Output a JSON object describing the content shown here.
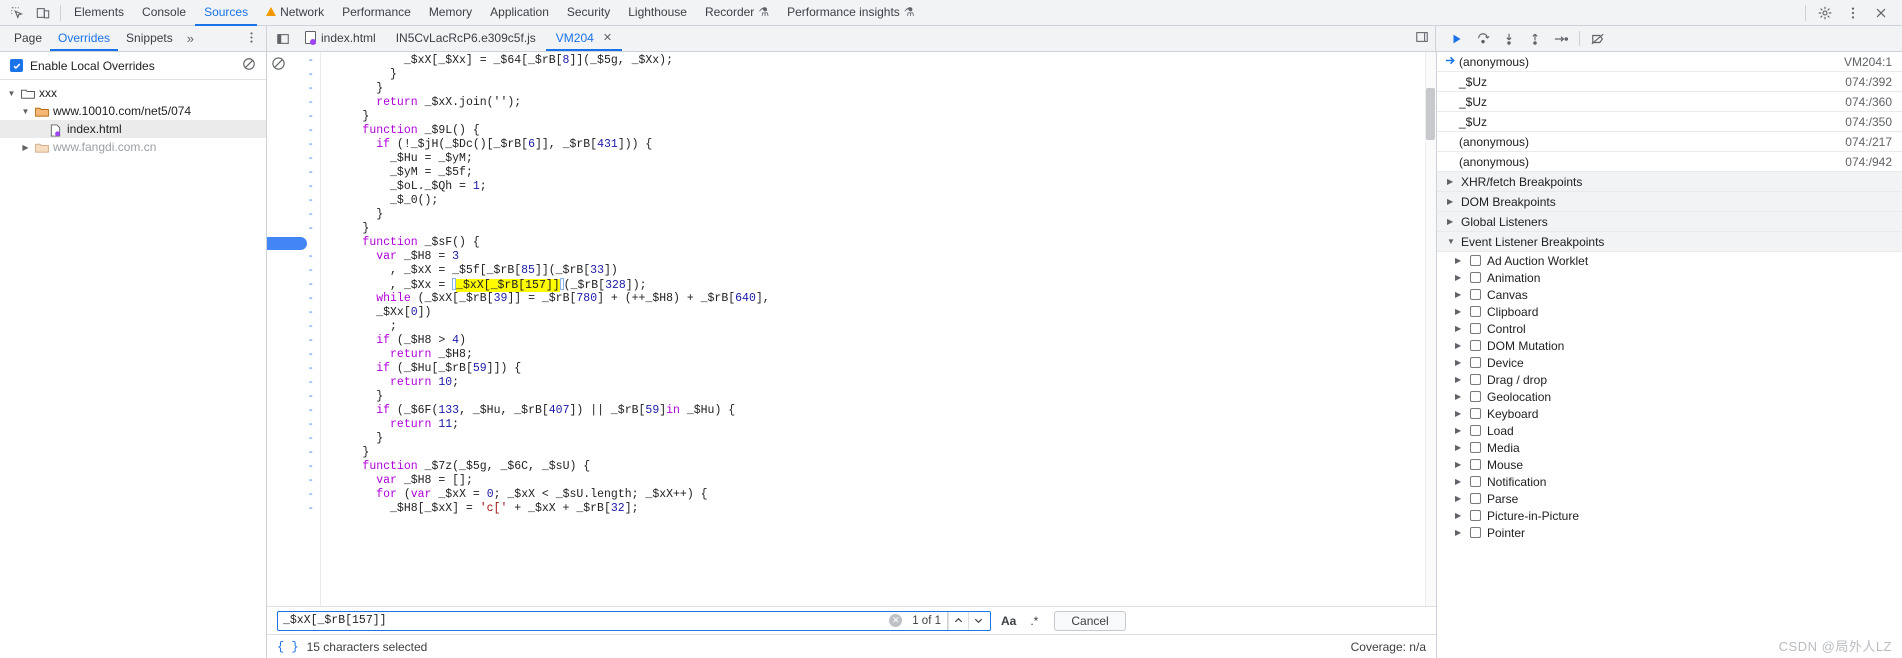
{
  "topbar": {
    "inspect_icon": "inspect-element-icon",
    "device_icon": "device-toolbar-icon",
    "tabs": [
      {
        "label": "Elements",
        "active": false,
        "warn": false,
        "flask": false
      },
      {
        "label": "Console",
        "active": false,
        "warn": false,
        "flask": false
      },
      {
        "label": "Sources",
        "active": true,
        "warn": false,
        "flask": false
      },
      {
        "label": "Network",
        "active": false,
        "warn": true,
        "flask": false
      },
      {
        "label": "Performance",
        "active": false,
        "warn": false,
        "flask": false
      },
      {
        "label": "Memory",
        "active": false,
        "warn": false,
        "flask": false
      },
      {
        "label": "Application",
        "active": false,
        "warn": false,
        "flask": false
      },
      {
        "label": "Security",
        "active": false,
        "warn": false,
        "flask": false
      },
      {
        "label": "Lighthouse",
        "active": false,
        "warn": false,
        "flask": false
      },
      {
        "label": "Recorder",
        "active": false,
        "warn": false,
        "flask": true
      },
      {
        "label": "Performance insights",
        "active": false,
        "warn": false,
        "flask": true
      }
    ],
    "settings_icon": "gear-icon",
    "more_icon": "more-vertical-icon",
    "close_icon": "close-icon"
  },
  "navigator": {
    "tabs": [
      {
        "label": "Page",
        "active": false
      },
      {
        "label": "Overrides",
        "active": true
      },
      {
        "label": "Snippets",
        "active": false
      }
    ],
    "more_label": "»",
    "kebab": "more-options-icon",
    "overrides_checkbox_label": "Enable Local Overrides",
    "overrides_checked": true,
    "clear_icon": "clear-overrides-icon",
    "tree": [
      {
        "label": "xxx",
        "depth": 0,
        "expanded": true,
        "type": "folder-plain",
        "selected": false,
        "muted": false
      },
      {
        "label": "www.10010.com/net5/074",
        "depth": 1,
        "expanded": true,
        "type": "folder-override",
        "selected": false,
        "muted": false
      },
      {
        "label": "index.html",
        "depth": 2,
        "expanded": null,
        "type": "file",
        "selected": true,
        "muted": false
      },
      {
        "label": "www.fangdi.com.cn",
        "depth": 1,
        "expanded": false,
        "type": "folder-override",
        "selected": false,
        "muted": true
      }
    ]
  },
  "editor": {
    "panel_toggle_icon": "show-navigator-icon",
    "tabs": [
      {
        "label": "index.html",
        "active": false,
        "icon": "html-file-override-icon",
        "closable": false
      },
      {
        "label": "IN5CvLacRcP6.e309c5f.js",
        "active": false,
        "icon": null,
        "closable": false
      },
      {
        "label": "VM204",
        "active": true,
        "icon": null,
        "closable": true
      }
    ],
    "tab_overflow_icon": "more-tabs-icon",
    "breakpoint_line_index": 13,
    "line_marker": "-",
    "lines": [
      [
        {
          "t": "            _$xX[_$Xx] = _$64[_$rB[",
          "c": ""
        },
        {
          "t": "8",
          "c": "n"
        },
        {
          "t": "]](_$5g, _$Xx);",
          "c": ""
        }
      ],
      [
        {
          "t": "          }",
          "c": ""
        }
      ],
      [
        {
          "t": "        }",
          "c": ""
        }
      ],
      [
        {
          "t": "        ",
          "c": ""
        },
        {
          "t": "return",
          "c": "k"
        },
        {
          "t": " _$xX.join('');",
          "c": ""
        }
      ],
      [
        {
          "t": "      }",
          "c": ""
        }
      ],
      [
        {
          "t": "      ",
          "c": ""
        },
        {
          "t": "function",
          "c": "k"
        },
        {
          "t": " _$9L() {",
          "c": ""
        }
      ],
      [
        {
          "t": "        ",
          "c": ""
        },
        {
          "t": "if",
          "c": "k"
        },
        {
          "t": " (!_$jH(_$Dc()[_$rB[",
          "c": ""
        },
        {
          "t": "6",
          "c": "n"
        },
        {
          "t": "]], _$rB[",
          "c": ""
        },
        {
          "t": "431",
          "c": "n"
        },
        {
          "t": "])) {",
          "c": ""
        }
      ],
      [
        {
          "t": "          _$Hu = _$yM;",
          "c": ""
        }
      ],
      [
        {
          "t": "          _$yM = _$5f;",
          "c": ""
        }
      ],
      [
        {
          "t": "          _$oL._$Qh = ",
          "c": ""
        },
        {
          "t": "1",
          "c": "n"
        },
        {
          "t": ";",
          "c": ""
        }
      ],
      [
        {
          "t": "          _$_0();",
          "c": ""
        }
      ],
      [
        {
          "t": "        }",
          "c": ""
        }
      ],
      [
        {
          "t": "      }",
          "c": ""
        }
      ],
      [
        {
          "t": "      ",
          "c": ""
        },
        {
          "t": "function",
          "c": "k"
        },
        {
          "t": " _$sF() {",
          "c": ""
        }
      ],
      [
        {
          "t": "        ",
          "c": ""
        },
        {
          "t": "var",
          "c": "k"
        },
        {
          "t": " _$H8 = ",
          "c": ""
        },
        {
          "t": "3",
          "c": "n"
        }
      ],
      [
        {
          "t": "          , _$xX = _$5f[_$rB[",
          "c": ""
        },
        {
          "t": "85",
          "c": "n"
        },
        {
          "t": "]](_$rB[",
          "c": ""
        },
        {
          "t": "33",
          "c": "n"
        },
        {
          "t": "])",
          "c": ""
        }
      ],
      [
        {
          "t": "          , _$Xx = ",
          "c": ""
        },
        {
          "t": "_$xX[_$rB[157]]",
          "c": "sel"
        },
        {
          "t": "(_$rB[",
          "c": ""
        },
        {
          "t": "328",
          "c": "n"
        },
        {
          "t": "]);",
          "c": ""
        }
      ],
      [
        {
          "t": "        ",
          "c": ""
        },
        {
          "t": "while",
          "c": "k"
        },
        {
          "t": " (_$xX[_$rB[",
          "c": ""
        },
        {
          "t": "39",
          "c": "n"
        },
        {
          "t": "]] = _$rB[",
          "c": ""
        },
        {
          "t": "780",
          "c": "n"
        },
        {
          "t": "] + (++_$H8) + _$rB[",
          "c": ""
        },
        {
          "t": "640",
          "c": "n"
        },
        {
          "t": "],",
          "c": ""
        }
      ],
      [
        {
          "t": "        _$Xx[",
          "c": ""
        },
        {
          "t": "0",
          "c": "n"
        },
        {
          "t": "])",
          "c": ""
        }
      ],
      [
        {
          "t": "          ;",
          "c": ""
        }
      ],
      [
        {
          "t": "        ",
          "c": ""
        },
        {
          "t": "if",
          "c": "k"
        },
        {
          "t": " (_$H8 > ",
          "c": ""
        },
        {
          "t": "4",
          "c": "n"
        },
        {
          "t": ")",
          "c": ""
        }
      ],
      [
        {
          "t": "          ",
          "c": ""
        },
        {
          "t": "return",
          "c": "k"
        },
        {
          "t": " _$H8;",
          "c": ""
        }
      ],
      [
        {
          "t": "        ",
          "c": ""
        },
        {
          "t": "if",
          "c": "k"
        },
        {
          "t": " (_$Hu[_$rB[",
          "c": ""
        },
        {
          "t": "59",
          "c": "n"
        },
        {
          "t": "]]) {",
          "c": ""
        }
      ],
      [
        {
          "t": "          ",
          "c": ""
        },
        {
          "t": "return",
          "c": "k"
        },
        {
          "t": " ",
          "c": ""
        },
        {
          "t": "10",
          "c": "n"
        },
        {
          "t": ";",
          "c": ""
        }
      ],
      [
        {
          "t": "        }",
          "c": ""
        }
      ],
      [
        {
          "t": "        ",
          "c": ""
        },
        {
          "t": "if",
          "c": "k"
        },
        {
          "t": " (_$6F(",
          "c": ""
        },
        {
          "t": "133",
          "c": "n"
        },
        {
          "t": ", _$Hu, _$rB[",
          "c": ""
        },
        {
          "t": "407",
          "c": "n"
        },
        {
          "t": "]) || _$rB[",
          "c": ""
        },
        {
          "t": "59",
          "c": "n"
        },
        {
          "t": "]",
          "c": ""
        },
        {
          "t": "in",
          "c": "k"
        },
        {
          "t": " _$Hu) {",
          "c": ""
        }
      ],
      [
        {
          "t": "          ",
          "c": ""
        },
        {
          "t": "return",
          "c": "k"
        },
        {
          "t": " ",
          "c": ""
        },
        {
          "t": "11",
          "c": "n"
        },
        {
          "t": ";",
          "c": ""
        }
      ],
      [
        {
          "t": "        }",
          "c": ""
        }
      ],
      [
        {
          "t": "      }",
          "c": ""
        }
      ],
      [
        {
          "t": "      ",
          "c": ""
        },
        {
          "t": "function",
          "c": "k"
        },
        {
          "t": " _$7z(_$5g, _$6C, _$sU) {",
          "c": ""
        }
      ],
      [
        {
          "t": "        ",
          "c": ""
        },
        {
          "t": "var",
          "c": "k"
        },
        {
          "t": " _$H8 = [];",
          "c": ""
        }
      ],
      [
        {
          "t": "        ",
          "c": ""
        },
        {
          "t": "for",
          "c": "k"
        },
        {
          "t": " (",
          "c": ""
        },
        {
          "t": "var",
          "c": "k"
        },
        {
          "t": " _$xX = ",
          "c": ""
        },
        {
          "t": "0",
          "c": "n"
        },
        {
          "t": "; _$xX < _$sU.length; _$xX++) {",
          "c": ""
        }
      ],
      [
        {
          "t": "          _$H8[_$xX] = ",
          "c": ""
        },
        {
          "t": "'c['",
          "c": "s"
        },
        {
          "t": " + _$xX + _$rB[",
          "c": ""
        },
        {
          "t": "32",
          "c": "n"
        },
        {
          "t": "];",
          "c": ""
        }
      ]
    ]
  },
  "search": {
    "value": "_$xX[_$rB[157]]",
    "placeholder": "Find",
    "clear_icon": "clear-search-icon",
    "match_count": "1 of 1",
    "prev_icon": "chevron-up-icon",
    "next_icon": "chevron-down-icon",
    "match_case_label": "Aa",
    "regex_label": ".*",
    "cancel_label": "Cancel"
  },
  "status": {
    "format_icon": "pretty-print-icon",
    "selection_text": "15 characters selected",
    "coverage_text": "Coverage: n/a"
  },
  "debugger": {
    "toolbar": [
      {
        "name": "resume-script-icon",
        "accent": true
      },
      {
        "name": "step-over-icon",
        "accent": false
      },
      {
        "name": "step-into-icon",
        "accent": false
      },
      {
        "name": "step-out-icon",
        "accent": false
      },
      {
        "name": "step-icon",
        "accent": false
      },
      {
        "name": "deactivate-breakpoints-icon",
        "accent": false
      }
    ],
    "call_stack": [
      {
        "name": "(anonymous)",
        "location": "VM204:1",
        "current": true
      },
      {
        "name": "_$Uz",
        "location": "074:/392",
        "current": false
      },
      {
        "name": "_$Uz",
        "location": "074:/360",
        "current": false
      },
      {
        "name": "_$Uz",
        "location": "074:/350",
        "current": false
      },
      {
        "name": "(anonymous)",
        "location": "074:/217",
        "current": false
      },
      {
        "name": "(anonymous)",
        "location": "074:/942",
        "current": false
      }
    ],
    "sections": [
      {
        "label": "XHR/fetch Breakpoints",
        "expanded": false
      },
      {
        "label": "DOM Breakpoints",
        "expanded": false
      },
      {
        "label": "Global Listeners",
        "expanded": false
      },
      {
        "label": "Event Listener Breakpoints",
        "expanded": true
      }
    ],
    "event_listener_breakpoints": [
      {
        "label": "Ad Auction Worklet",
        "checked": false
      },
      {
        "label": "Animation",
        "checked": false
      },
      {
        "label": "Canvas",
        "checked": false
      },
      {
        "label": "Clipboard",
        "checked": false
      },
      {
        "label": "Control",
        "checked": false
      },
      {
        "label": "DOM Mutation",
        "checked": false
      },
      {
        "label": "Device",
        "checked": false
      },
      {
        "label": "Drag / drop",
        "checked": false
      },
      {
        "label": "Geolocation",
        "checked": false
      },
      {
        "label": "Keyboard",
        "checked": false
      },
      {
        "label": "Load",
        "checked": false
      },
      {
        "label": "Media",
        "checked": false
      },
      {
        "label": "Mouse",
        "checked": false
      },
      {
        "label": "Notification",
        "checked": false
      },
      {
        "label": "Parse",
        "checked": false
      },
      {
        "label": "Picture-in-Picture",
        "checked": false
      },
      {
        "label": "Pointer",
        "checked": false
      }
    ]
  },
  "watermark": {
    "text": "CSDN @局外人LZ"
  },
  "colors": {
    "accent": "#1a73e8",
    "highlight": "#fffb00",
    "breakpoint": "#4285f4"
  }
}
